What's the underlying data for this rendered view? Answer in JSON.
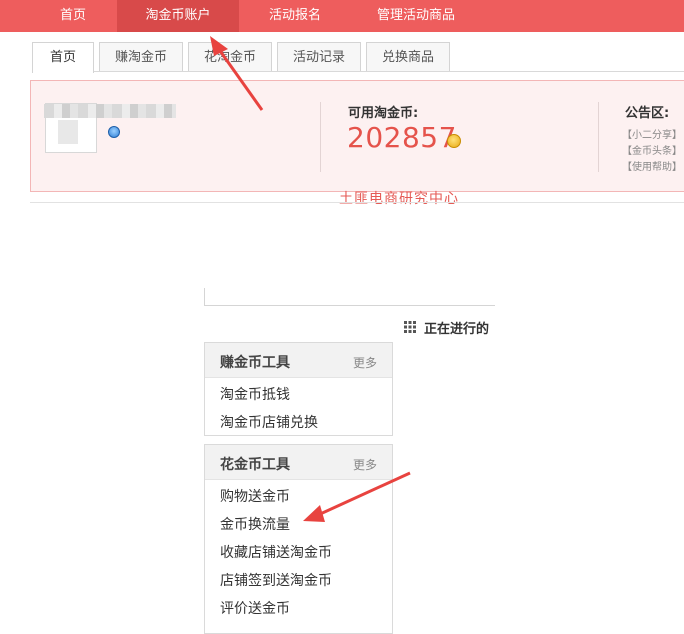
{
  "topnav": {
    "items": [
      {
        "label": "首页"
      },
      {
        "label": "淘金币账户"
      },
      {
        "label": "活动报名"
      },
      {
        "label": "管理活动商品"
      }
    ],
    "active_index": 1
  },
  "tabs": {
    "items": [
      {
        "label": "首页"
      },
      {
        "label": "赚淘金币"
      },
      {
        "label": "花淘金币"
      },
      {
        "label": "活动记录"
      },
      {
        "label": "兑换商品"
      }
    ],
    "active_index": 0
  },
  "account": {
    "coins_label": "可用淘金币:",
    "coins_value": "202857"
  },
  "notice": {
    "title": "公告区:",
    "items": [
      "【小二分享】",
      "【金币头条】",
      "【使用帮助】"
    ]
  },
  "watermark": "土匪电商研究中心",
  "ongoing_label": "正在进行的",
  "earn_tools": {
    "title": "赚金币工具",
    "more": "更多",
    "links": [
      "淘金币抵钱",
      "淘金币店铺兑换"
    ]
  },
  "spend_tools": {
    "title": "花金币工具",
    "more": "更多",
    "links": [
      "购物送金币",
      "金币换流量",
      "收藏店铺送淘金币",
      "店铺签到送淘金币",
      "评价送金币"
    ]
  },
  "colors": {
    "nav_bg": "#ee5d5d",
    "nav_active": "#d84a4a",
    "accent": "#e5534b",
    "panel_head": "#f2f2f2"
  },
  "icons": [
    "vip-icon",
    "gold-coin-icon",
    "grid-icon"
  ]
}
